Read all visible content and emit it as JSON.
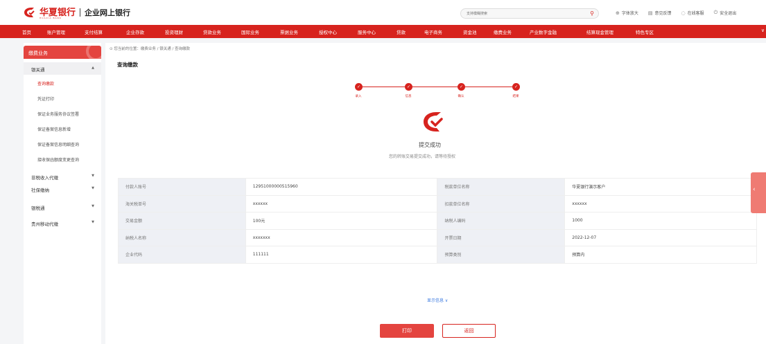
{
  "header": {
    "logo_text": "华夏银行",
    "logo_sub": "HUAXIA BANK",
    "title": "企业网上银行",
    "search_placeholder": "支持模糊搜索",
    "tools": [
      {
        "icon": "magnify-icon",
        "glyph": "⊕",
        "label": "字体放大"
      },
      {
        "icon": "feedback-icon",
        "glyph": "▤",
        "label": "意见反馈"
      },
      {
        "icon": "service-icon",
        "glyph": "◌",
        "label": "在线客服"
      },
      {
        "icon": "power-icon",
        "glyph": "⏻",
        "label": "安全退出"
      }
    ]
  },
  "nav": {
    "items": [
      "首页",
      "账户管理",
      "支付结算",
      "企业存款",
      "投资理财",
      "贷款业务",
      "国际业务",
      "票据业务",
      "授权中心",
      "服务中心",
      "贷款",
      "电子商务",
      "资金池",
      "缴费业务",
      "产业数字金融",
      "结算现金管理",
      "特色专区"
    ]
  },
  "sidebar": {
    "header": "缴费业务",
    "groups": [
      {
        "label": "银关通",
        "open": true,
        "items": [
          "查询缴款",
          "凭证打印",
          "保证业务服务协议签署",
          "保证备案信息新增",
          "保证备案信息明细查询",
          "接收保函额度变更查询"
        ]
      },
      {
        "label": "非税收入代缴",
        "open": false
      },
      {
        "label": "社保缴纳",
        "open": false
      },
      {
        "label": "银税通",
        "open": false
      },
      {
        "label": "贵州移动代缴",
        "open": false
      }
    ],
    "active_item": "查询缴款"
  },
  "main": {
    "breadcrumb": "⊙ 您当前的位置：缴费业务 / 银关通 / 查询缴款",
    "title": "查询缴款",
    "steps": [
      "录入",
      "信息",
      "确认",
      "结果"
    ],
    "success_title": "提交成功",
    "success_desc": "您的转账交易提交成功，请等待授权",
    "table": [
      [
        "付款人账号",
        "12951000000515960",
        "税款单位名称",
        "华夏银行演示客户"
      ],
      [
        "海关税单号",
        "xxxxxx",
        "扣款单位名称",
        "xxxxxx"
      ],
      [
        "交易金额",
        "100元",
        "纳税人编码",
        "1000"
      ],
      [
        "纳税人名称",
        "xxxxxxx",
        "开票日期",
        "2022-12-07"
      ],
      [
        "企业代码",
        "111111",
        "预算类别",
        "预算内"
      ]
    ],
    "more_info": "显示信息 ∨",
    "print_label": "打印",
    "back_label": "返回"
  },
  "colors": {
    "brand": "#d7231e",
    "accent": "#e4443f",
    "link": "#3b7ae0"
  }
}
